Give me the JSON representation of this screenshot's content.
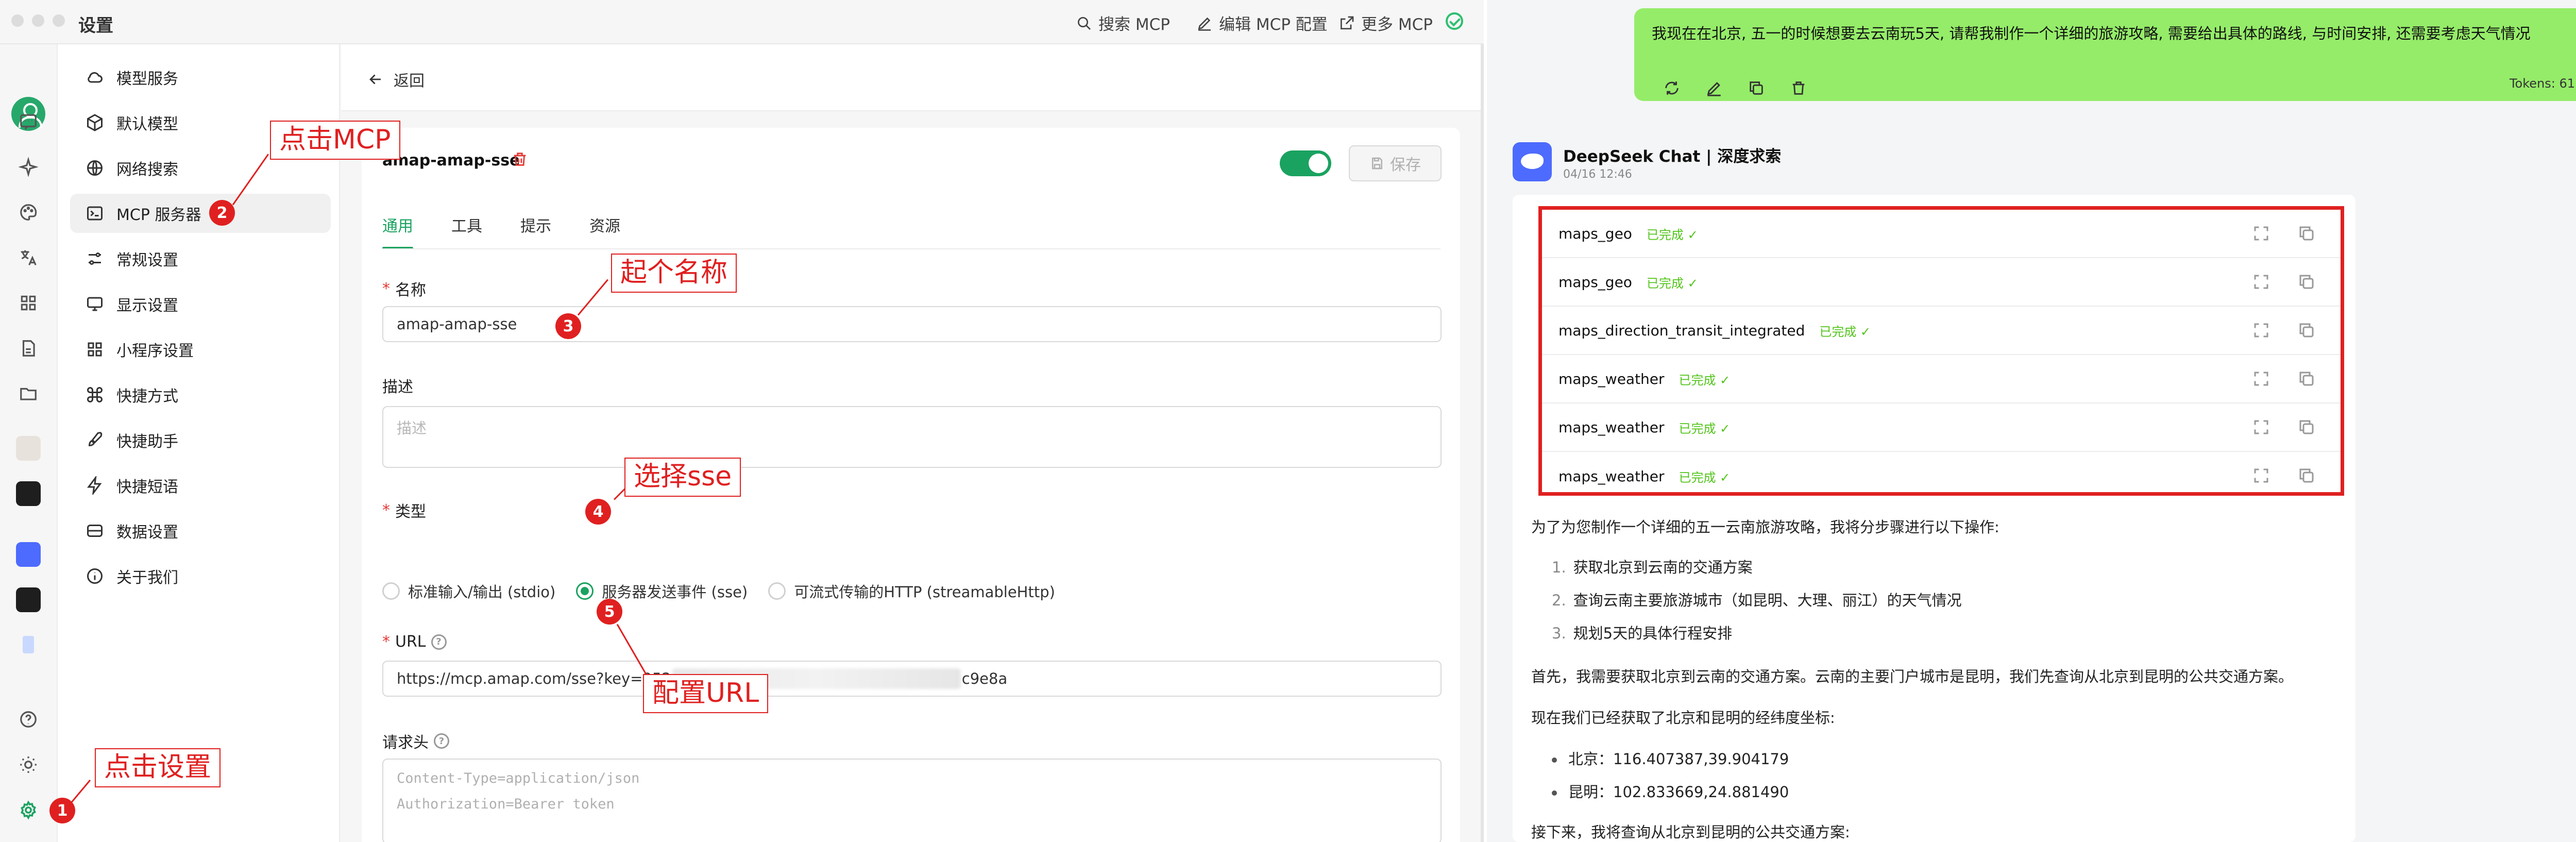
{
  "app": {
    "title": "设置",
    "top_actions": [
      "搜索 MCP",
      "编辑 MCP 配置",
      "更多 MCP"
    ]
  },
  "nav": {
    "items": [
      {
        "label": "模型服务",
        "icon": "cloud-icon"
      },
      {
        "label": "默认模型",
        "icon": "cube-icon"
      },
      {
        "label": "网络搜索",
        "icon": "globe-icon"
      },
      {
        "label": "MCP 服务器",
        "icon": "terminal-icon",
        "active": true
      },
      {
        "label": "常规设置",
        "icon": "sliders-icon"
      },
      {
        "label": "显示设置",
        "icon": "monitor-icon"
      },
      {
        "label": "小程序设置",
        "icon": "grid-icon"
      },
      {
        "label": "快捷方式",
        "icon": "command-icon"
      },
      {
        "label": "快捷助手",
        "icon": "rocket-icon"
      },
      {
        "label": "快捷短语",
        "icon": "zap-icon"
      },
      {
        "label": "数据设置",
        "icon": "database-icon"
      },
      {
        "label": "关于我们",
        "icon": "info-icon"
      }
    ]
  },
  "detail": {
    "back_label": "返回",
    "server_name": "amap-amap-sse",
    "save_label": "保存",
    "enabled": true,
    "tabs": [
      "通用",
      "工具",
      "提示",
      "资源"
    ],
    "active_tab": "通用",
    "name_label": "名称",
    "name_value": "amap-amap-sse",
    "desc_label": "描述",
    "desc_placeholder": "描述",
    "type_label": "类型",
    "types": [
      "标准输入/输出 (stdio)",
      "服务器发送事件 (sse)",
      "可流式传输的HTTP (streamableHttp)"
    ],
    "selected_type": "服务器发送事件 (sse)",
    "url_label": "URL",
    "url_prefix": "https://mcp.amap.com/sse?key=952",
    "url_suffix": "c9e8a",
    "headers_label": "请求头",
    "headers_placeholder": [
      "Content-Type=application/json",
      "Authorization=Bearer token"
    ]
  },
  "annotations": [
    {
      "num": "1",
      "text": "点击设置"
    },
    {
      "num": "2",
      "text": "点击MCP"
    },
    {
      "num": "3",
      "text": "起个名称"
    },
    {
      "num": "4",
      "text": "选择sse"
    },
    {
      "num": "5",
      "text": "配置URL"
    }
  ],
  "chat": {
    "user_message": "我现在在北京, 五一的时候想要去云南玩5天, 请帮我制作一个详细的旅游攻略, 需要给出具体的路线, 与时间安排, 还需要考虑天气情况",
    "tokens": "Tokens: 61",
    "assistant_name": "DeepSeek Chat | 深度求索",
    "assistant_date": "04/16 12:46",
    "tool_calls": [
      {
        "name": "maps_geo",
        "status": "已完成 ✓"
      },
      {
        "name": "maps_geo",
        "status": "已完成 ✓"
      },
      {
        "name": "maps_direction_transit_integrated",
        "status": "已完成 ✓"
      },
      {
        "name": "maps_weather",
        "status": "已完成 ✓"
      },
      {
        "name": "maps_weather",
        "status": "已完成 ✓"
      },
      {
        "name": "maps_weather",
        "status": "已完成 ✓"
      }
    ],
    "answer_intro": "为了为您制作一个详细的五一云南旅游攻略，我将分步骤进行以下操作:",
    "steps": [
      "获取北京到云南的交通方案",
      "查询云南主要旅游城市（如昆明、大理、丽江）的天气情况",
      "规划5天的具体行程安排"
    ],
    "para1": "首先，我需要获取北京到云南的交通方案。云南的主要门户城市是昆明，我们先查询从北京到昆明的公共交通方案。",
    "para2": "现在我们已经获取了北京和昆明的经纬度坐标:",
    "coords": [
      "北京：116.407387,39.904179",
      "昆明：102.833669,24.881490"
    ],
    "para3": "接下来，我将查询从北京到昆明的公共交通方案:"
  }
}
